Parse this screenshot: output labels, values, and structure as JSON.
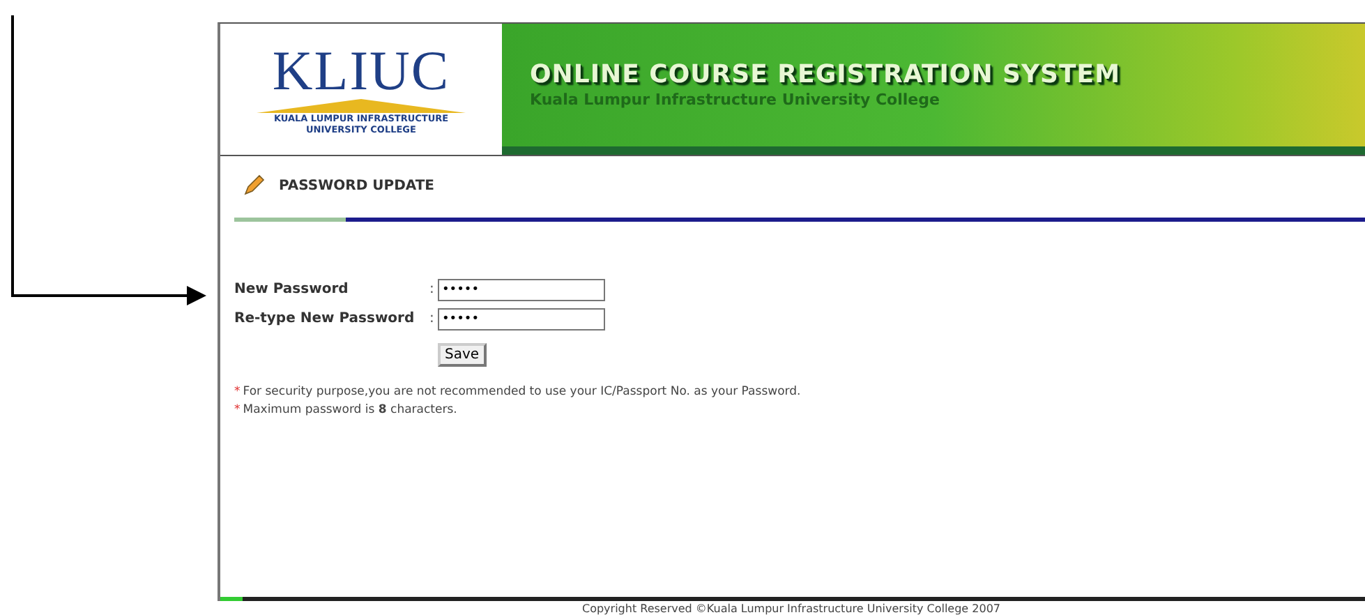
{
  "logo": {
    "name": "KLIUC",
    "subtitle_line_1": "KUALA LUMPUR INFRASTRUCTURE",
    "subtitle_line_2": "UNIVERSITY COLLEGE"
  },
  "banner": {
    "title": "ONLINE COURSE REGISTRATION SYSTEM",
    "subtitle": "Kuala Lumpur Infrastructure University College"
  },
  "section_title": "PASSWORD UPDATE",
  "fields": [
    {
      "label": "New Password",
      "separator": ":",
      "value": "•••••"
    },
    {
      "label": "Re-type New Password",
      "separator": ":",
      "value": "•••••"
    }
  ],
  "save_button": "Save",
  "notes": [
    {
      "marker": "*",
      "text": "For security purpose,you are not recommended to use your IC/Passport No. as your Password."
    },
    {
      "marker": "*",
      "text": "Maximum password is **8** characters."
    }
  ],
  "footer": "Copyright Reserved ©Kuala Lumpur Infrastructure University College 2007"
}
